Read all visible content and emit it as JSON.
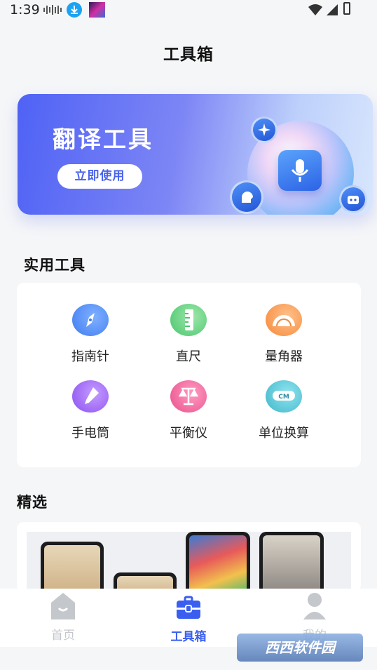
{
  "status_bar": {
    "time": "1:39"
  },
  "header": {
    "title": "工具箱"
  },
  "banner": {
    "title": "翻译工具",
    "button_label": "立即使用"
  },
  "tools_section": {
    "title": "实用工具",
    "items": [
      {
        "label": "指南针",
        "icon": "compass-icon",
        "color": "#3f7bf0"
      },
      {
        "label": "直尺",
        "icon": "ruler-icon",
        "color": "#47c66d"
      },
      {
        "label": "量角器",
        "icon": "protractor-icon",
        "color": "#f5883a"
      },
      {
        "label": "手电筒",
        "icon": "flashlight-icon",
        "color": "#8b4ff0"
      },
      {
        "label": "平衡仪",
        "icon": "level-icon",
        "color": "#e84f8b"
      },
      {
        "label": "单位换算",
        "icon": "unit-convert-icon",
        "color": "#3fb6c9"
      }
    ]
  },
  "featured_section": {
    "title": "精选"
  },
  "tab_bar": {
    "items": [
      {
        "label": "首页",
        "icon": "home-icon",
        "active": false
      },
      {
        "label": "工具箱",
        "icon": "toolbox-icon",
        "active": true
      },
      {
        "label": "我的",
        "icon": "user-icon",
        "active": false
      }
    ]
  },
  "watermark": {
    "text": "西西软件园"
  },
  "colors": {
    "accent": "#3a5ff0",
    "inactive": "#c4c7cc"
  }
}
